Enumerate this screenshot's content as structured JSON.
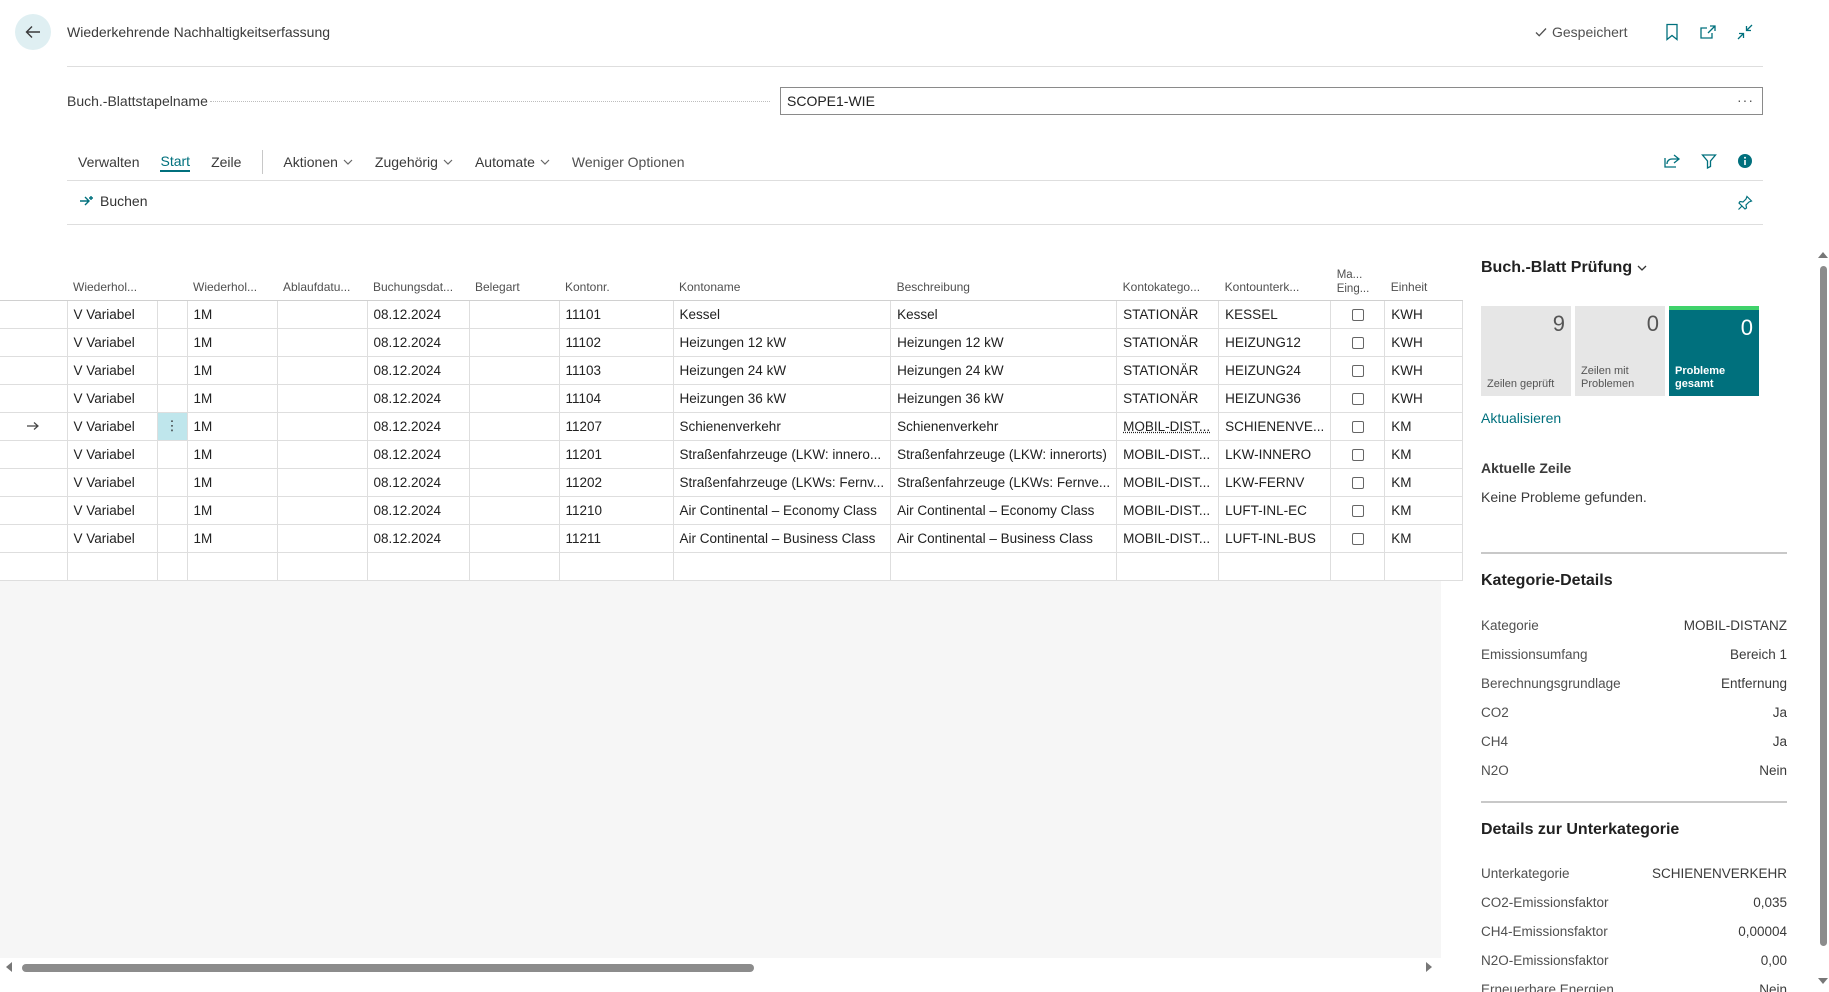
{
  "header": {
    "title": "Wiederkehrende Nachhaltigkeitserfassung",
    "saved_label": "Gespeichert"
  },
  "batch": {
    "label": "Buch.-Blattstapelname",
    "value": "SCOPE1-WIE"
  },
  "tabs": [
    {
      "label": "Verwalten"
    },
    {
      "label": "Start"
    },
    {
      "label": "Zeile"
    },
    {
      "label": "Aktionen"
    },
    {
      "label": "Zugehörig"
    },
    {
      "label": "Automate"
    },
    {
      "label": "Weniger Optionen"
    }
  ],
  "actions": {
    "post_label": "Buchen"
  },
  "table": {
    "columns": [
      "Wiederhol...",
      "Wiederhol...",
      "Ablaufdatu...",
      "Buchungsdat...",
      "Belegart",
      "Kontonr.",
      "Kontoname",
      "Beschreibung",
      "Kontokatego...",
      "Kontounterk...",
      "Ma... Eing...",
      "Einheit"
    ],
    "rows": [
      {
        "method": "V Variabel",
        "freq": "1M",
        "expiry": "",
        "date": "08.12.2024",
        "doctype": "",
        "no": "11101",
        "name": "Kessel",
        "desc": "Kessel",
        "cat": "STATIONÄR",
        "subcat": "KESSEL",
        "unit": "KWH"
      },
      {
        "method": "V Variabel",
        "freq": "1M",
        "expiry": "",
        "date": "08.12.2024",
        "doctype": "",
        "no": "11102",
        "name": "Heizungen 12 kW",
        "desc": "Heizungen 12 kW",
        "cat": "STATIONÄR",
        "subcat": "HEIZUNG12",
        "unit": "KWH"
      },
      {
        "method": "V Variabel",
        "freq": "1M",
        "expiry": "",
        "date": "08.12.2024",
        "doctype": "",
        "no": "11103",
        "name": "Heizungen 24 kW",
        "desc": "Heizungen 24 kW",
        "cat": "STATIONÄR",
        "subcat": "HEIZUNG24",
        "unit": "KWH"
      },
      {
        "method": "V Variabel",
        "freq": "1M",
        "expiry": "",
        "date": "08.12.2024",
        "doctype": "",
        "no": "11104",
        "name": "Heizungen 36 kW",
        "desc": "Heizungen 36 kW",
        "cat": "STATIONÄR",
        "subcat": "HEIZUNG36",
        "unit": "KWH"
      },
      {
        "method": "V Variabel",
        "freq": "1M",
        "expiry": "",
        "date": "08.12.2024",
        "doctype": "",
        "no": "11207",
        "name": "Schienenverkehr",
        "desc": "Schienenverkehr",
        "cat": "MOBIL-DIST...",
        "subcat": "SCHIENENVE...",
        "unit": "KM"
      },
      {
        "method": "V Variabel",
        "freq": "1M",
        "expiry": "",
        "date": "08.12.2024",
        "doctype": "",
        "no": "11201",
        "name": "Straßenfahrzeuge (LKW: innero...",
        "desc": "Straßenfahrzeuge (LKW: innerorts)",
        "cat": "MOBIL-DIST...",
        "subcat": "LKW-INNERO",
        "unit": "KM"
      },
      {
        "method": "V Variabel",
        "freq": "1M",
        "expiry": "",
        "date": "08.12.2024",
        "doctype": "",
        "no": "11202",
        "name": "Straßenfahrzeuge (LKWs: Fernv...",
        "desc": "Straßenfahrzeuge (LKWs: Fernve...",
        "cat": "MOBIL-DIST...",
        "subcat": "LKW-FERNV",
        "unit": "KM"
      },
      {
        "method": "V Variabel",
        "freq": "1M",
        "expiry": "",
        "date": "08.12.2024",
        "doctype": "",
        "no": "11210",
        "name": "Air Continental – Economy Class",
        "desc": "Air Continental – Economy Class",
        "cat": "MOBIL-DIST...",
        "subcat": "LUFT-INL-EC",
        "unit": "KM"
      },
      {
        "method": "V Variabel",
        "freq": "1M",
        "expiry": "",
        "date": "08.12.2024",
        "doctype": "",
        "no": "11211",
        "name": "Air Continental – Business Class",
        "desc": "Air Continental – Business Class",
        "cat": "MOBIL-DIST...",
        "subcat": "LUFT-INL-BUS",
        "unit": "KM"
      }
    ]
  },
  "factbox": {
    "title": "Buch.-Blatt Prüfung",
    "tiles": [
      {
        "value": "9",
        "label": "Zeilen geprüft"
      },
      {
        "value": "0",
        "label": "Zeilen mit Problemen"
      },
      {
        "value": "0",
        "label": "Probleme gesamt"
      }
    ],
    "refresh_label": "Aktualisieren",
    "current_line_title": "Aktuelle Zeile",
    "current_line_text": "Keine Probleme gefunden.",
    "category_title": "Kategorie-Details",
    "category": [
      {
        "key": "Kategorie",
        "value": "MOBIL-DISTANZ"
      },
      {
        "key": "Emissionsumfang",
        "value": "Bereich 1"
      },
      {
        "key": "Berechnungsgrundlage",
        "value": "Entfernung"
      },
      {
        "key": "CO2",
        "value": "Ja"
      },
      {
        "key": "CH4",
        "value": "Ja"
      },
      {
        "key": "N2O",
        "value": "Nein"
      }
    ],
    "subcategory_title": "Details zur Unterkategorie",
    "subcategory": [
      {
        "key": "Unterkategorie",
        "value": "SCHIENENVERKEHR"
      },
      {
        "key": "CO2-Emissionsfaktor",
        "value": "0,035"
      },
      {
        "key": "CH4-Emissionsfaktor",
        "value": "0,00004"
      },
      {
        "key": "N2O-Emissionsfaktor",
        "value": "0,00"
      },
      {
        "key": "Erneuerbare Energien",
        "value": "Nein"
      }
    ]
  },
  "colors": {
    "accent": "#00707d",
    "tile_grey": "#e6e6e6",
    "tile_success_bar": "#3fd26b",
    "selected_cell": "#bfe6ec"
  }
}
